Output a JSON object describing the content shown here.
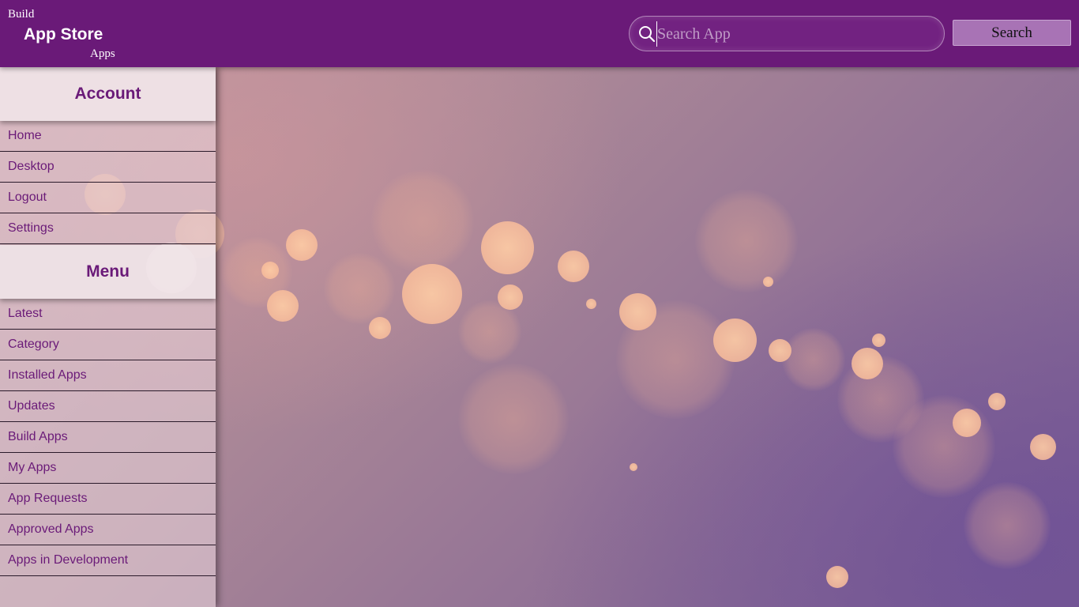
{
  "header": {
    "brand_top": "Build",
    "brand_main": "App Store",
    "brand_bottom": "Apps",
    "search_placeholder": "Search App",
    "search_icon": "magnifier-icon",
    "search_button_label": "Search"
  },
  "sidebar": {
    "account_heading": "Account",
    "account_items": [
      {
        "label": "Home"
      },
      {
        "label": "Desktop"
      },
      {
        "label": "Logout"
      },
      {
        "label": "Settings"
      }
    ],
    "menu_heading": "Menu",
    "menu_items": [
      {
        "label": "Latest"
      },
      {
        "label": "Category"
      },
      {
        "label": "Installed Apps"
      },
      {
        "label": "Updates"
      },
      {
        "label": "Build Apps"
      },
      {
        "label": "My Apps"
      },
      {
        "label": "App Requests"
      },
      {
        "label": "Approved Apps"
      },
      {
        "label": "Apps in Development"
      }
    ]
  },
  "colors": {
    "header_bg": "#6a1a78",
    "accent_text": "#6a1a78",
    "search_button_bg": "#a873b5"
  }
}
